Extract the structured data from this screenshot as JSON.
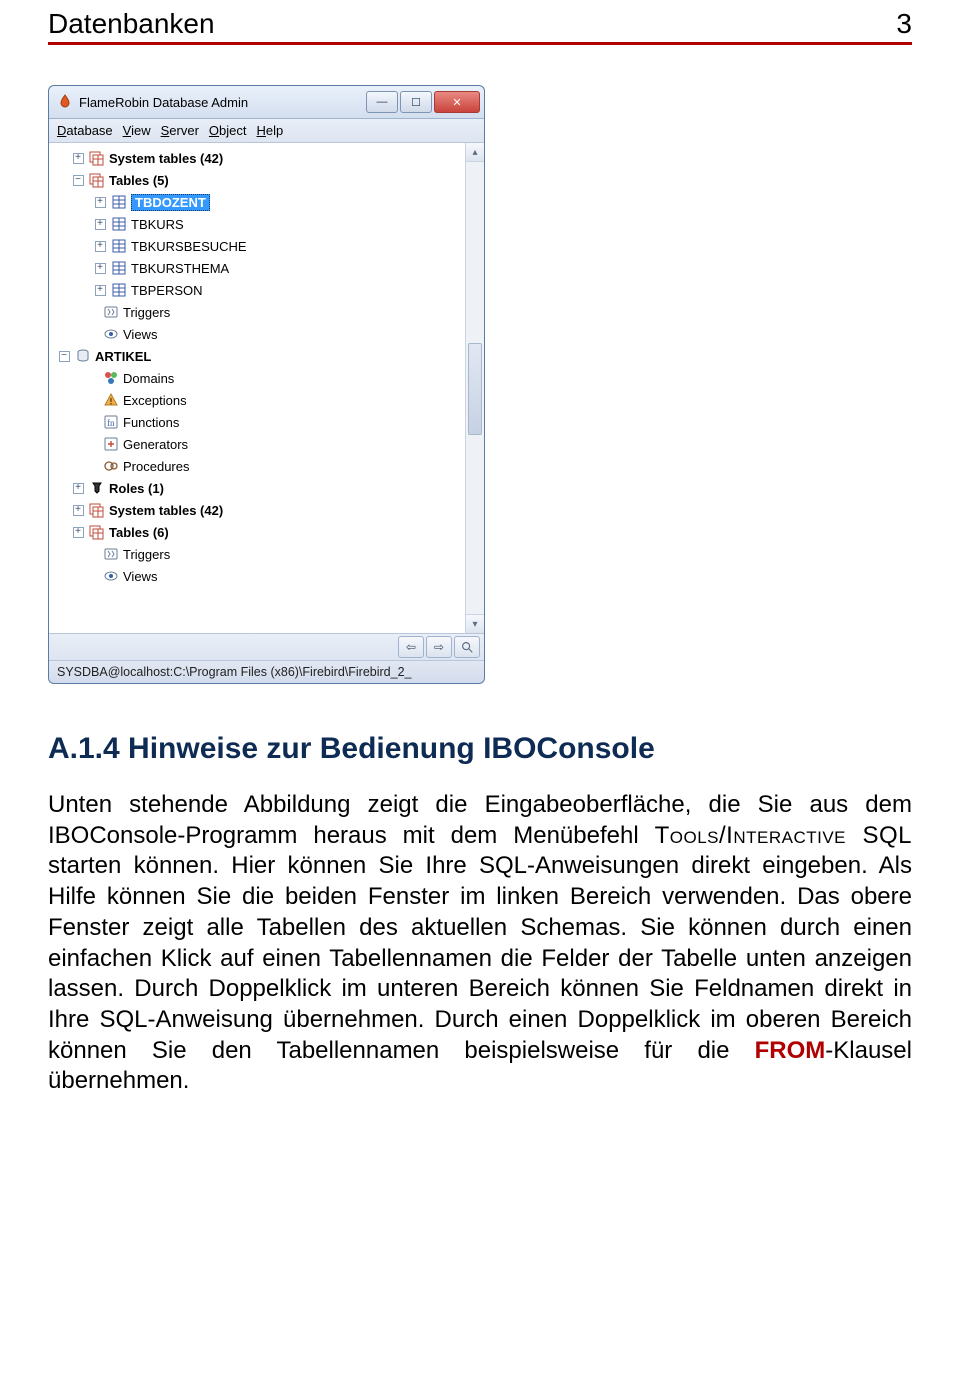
{
  "header": {
    "title": "Datenbanken",
    "page": "3"
  },
  "window": {
    "title": "FlameRobin Database Admin",
    "menu": {
      "database": "Database",
      "view": "View",
      "server": "Server",
      "object": "Object",
      "help": "Help"
    },
    "tree": {
      "systables1": "System tables (42)",
      "tables1": "Tables (5)",
      "t_tbdozent": "TBDOZENT",
      "t_tbkurs": "TBKURS",
      "t_tbkursbesuche": "TBKURSBESUCHE",
      "t_tbkursthema": "TBKURSTHEMA",
      "t_tbperson": "TBPERSON",
      "triggers1": "Triggers",
      "views1": "Views",
      "artikel": "ARTIKEL",
      "domains": "Domains",
      "exceptions": "Exceptions",
      "functions": "Functions",
      "generators": "Generators",
      "procedures": "Procedures",
      "roles": "Roles (1)",
      "systables2": "System tables (42)",
      "tables2": "Tables (6)",
      "triggers2": "Triggers",
      "views2": "Views"
    },
    "status": "SYSDBA@localhost:C:\\Program Files (x86)\\Firebird\\Firebird_2_"
  },
  "section": {
    "title": "A.1.4  Hinweise zur Bedienung IBOConsole",
    "p1a": "Unten stehende Abbildung zeigt die Eingabeoberfläche, die Sie aus dem IBOConsole-Programm heraus mit dem Menübefehl ",
    "p1b": "Tools/Interactive SQL",
    "p1c": " starten können. Hier können Sie Ihre SQL-Anweisungen direkt eingeben. Als Hilfe können Sie die beiden Fenster im linken Bereich verwenden. Das obere Fenster zeigt alle Tabellen des aktuellen Schemas. Sie können durch einen einfachen Klick auf einen Tabellennamen die Felder der Tabelle unten anzeigen lassen. Durch Doppelklick im unteren Bereich können Sie Feldnamen direkt in Ihre SQL-Anweisung übernehmen. Durch einen Doppelklick im oberen Bereich können Sie den Tabellennamen beispielsweise für die ",
    "from": "FROM",
    "p1d": "-Klausel übernehmen."
  }
}
